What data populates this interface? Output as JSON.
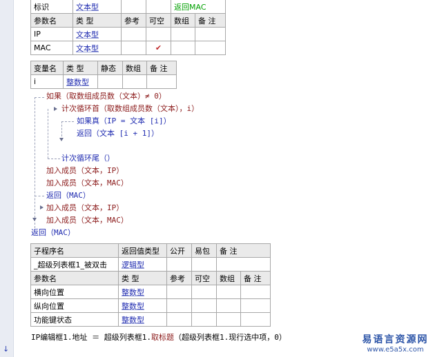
{
  "params_table_1": {
    "top_row": [
      "标识",
      "文本型",
      "",
      "",
      "返回MAC"
    ],
    "headers": [
      "参数名",
      "类 型",
      "参考",
      "可空",
      "数组",
      "备 注"
    ],
    "rows": [
      {
        "name": "IP",
        "type": "文本型",
        "ref": "",
        "nullable": "",
        "array": "",
        "note": ""
      },
      {
        "name": "MAC",
        "type": "文本型",
        "ref": "",
        "nullable": "✔",
        "array": "",
        "note": ""
      }
    ]
  },
  "vars_table": {
    "headers": [
      "变量名",
      "类 型",
      "静态",
      "数组",
      "备 注"
    ],
    "rows": [
      {
        "name": "i",
        "type": "整数型",
        "static": "",
        "array": "",
        "note": ""
      }
    ]
  },
  "code_lines": [
    {
      "text": "如果（取数组成员数（文本）≠ 0）",
      "style": "kw-red"
    },
    {
      "text": "计次循环首（取数组成员数（文本），i）",
      "style": "kw-red"
    },
    {
      "text": "如果真（IP = 文本 [i]）",
      "style": "kw-blue"
    },
    {
      "text": "返回（文本 [i + 1]）",
      "style": "kw-blue"
    },
    {
      "text": "计次循环尾（）",
      "style": "kw-blue"
    },
    {
      "text": "加入成员（文本，IP）",
      "style": "kw-red"
    },
    {
      "text": "加入成员（文本，MAC）",
      "style": "kw-red"
    },
    {
      "text": "返回（MAC）",
      "style": "kw-blue"
    },
    {
      "text": "加入成员（文本，IP）",
      "style": "kw-red"
    },
    {
      "text": "加入成员（文本，MAC）",
      "style": "kw-red"
    },
    {
      "text": "返回（MAC）",
      "style": "kw-blue"
    }
  ],
  "sub_table": {
    "headers": [
      "子程序名",
      "返回值类型",
      "公开",
      "易包",
      "备 注"
    ],
    "row": {
      "name": "_超级列表框1_被双击",
      "ret": "逻辑型",
      "public": "",
      "pkg": "",
      "note": ""
    },
    "param_headers": [
      "参数名",
      "类 型",
      "参考",
      "可空",
      "数组",
      "备 注"
    ],
    "params": [
      {
        "name": "横向位置",
        "type": "整数型"
      },
      {
        "name": "纵向位置",
        "type": "整数型"
      },
      {
        "name": "功能键状态",
        "type": "整数型"
      }
    ]
  },
  "bottom_code": {
    "a": "IP编辑框1.地址 ＝ 超级列表框1.",
    "b": "取标题",
    "c": "（超级列表框1.现行选中项，0）"
  },
  "watermark": {
    "title": "易语言资源网",
    "url": "www.e5a5x.com"
  },
  "icons": {
    "gutter_arrow": "↓"
  }
}
